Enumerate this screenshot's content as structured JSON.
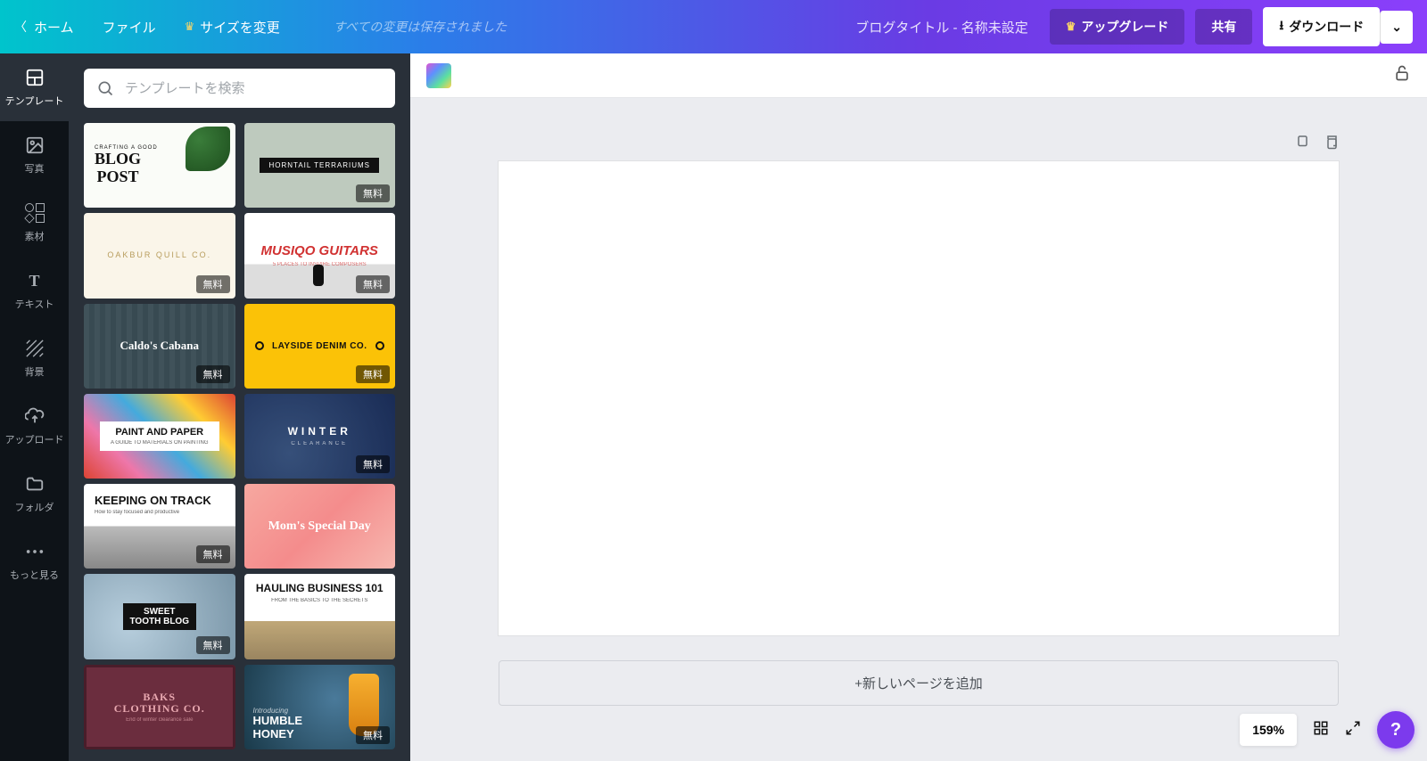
{
  "topbar": {
    "home": "ホーム",
    "file": "ファイル",
    "resize": "サイズを変更",
    "save_status": "すべての変更は保存されました",
    "doc_title": "ブログタイトル - 名称未設定",
    "upgrade": "アップグレード",
    "share": "共有",
    "download": "ダウンロード"
  },
  "sidebar": {
    "templates": "テンプレート",
    "photos": "写真",
    "elements": "素材",
    "text": "テキスト",
    "background": "背景",
    "uploads": "アップロード",
    "folders": "フォルダ",
    "more": "もっと見る"
  },
  "search": {
    "placeholder": "テンプレートを検索"
  },
  "templates": [
    {
      "title": "BLOG\nPOST",
      "sub": "CRAFTING A GOOD",
      "style": "t1",
      "free": false
    },
    {
      "title": "HORNTAIL TERRARIUMS",
      "sub": "",
      "style": "t2",
      "free": true
    },
    {
      "title": "OAKBUR QUILL CO.",
      "sub": "",
      "style": "t3",
      "free": true
    },
    {
      "title": "MUSIQO GUITARS",
      "sub": "5 PLACES TO INSPIRE COMPOSERS",
      "style": "t4",
      "free": true
    },
    {
      "title": "Caldo's Cabana",
      "sub": "",
      "style": "t5",
      "free": true
    },
    {
      "title": "LAYSIDE DENIM CO.",
      "sub": "",
      "style": "t6",
      "free": true
    },
    {
      "title": "PAINT AND PAPER",
      "sub": "A GUIDE TO MATERIALS ON PAINTING",
      "style": "t7",
      "free": false
    },
    {
      "title": "WINTER",
      "sub": "CLEARANCE",
      "style": "t8",
      "free": true
    },
    {
      "title": "KEEPING ON TRACK",
      "sub": "How to stay focused and productive",
      "style": "t9",
      "free": true
    },
    {
      "title": "Mom's Special Day",
      "sub": "",
      "style": "t10",
      "free": false
    },
    {
      "title": "SWEET\nTOOTH BLOG",
      "sub": "",
      "style": "t11",
      "free": true
    },
    {
      "title": "HAULING BUSINESS 101",
      "sub": "FROM THE BASICS TO THE SECRETS",
      "style": "t12",
      "free": false
    },
    {
      "title": "BAKS\nCLOTHING CO.",
      "sub": "End of winter clearance sale",
      "style": "t13",
      "free": false
    },
    {
      "title": "HUMBLE\nHONEY",
      "sub": "Introducing",
      "style": "t14",
      "free": true
    }
  ],
  "badge_free": "無料",
  "canvas": {
    "add_page": "+新しいページを追加",
    "zoom": "159%"
  }
}
